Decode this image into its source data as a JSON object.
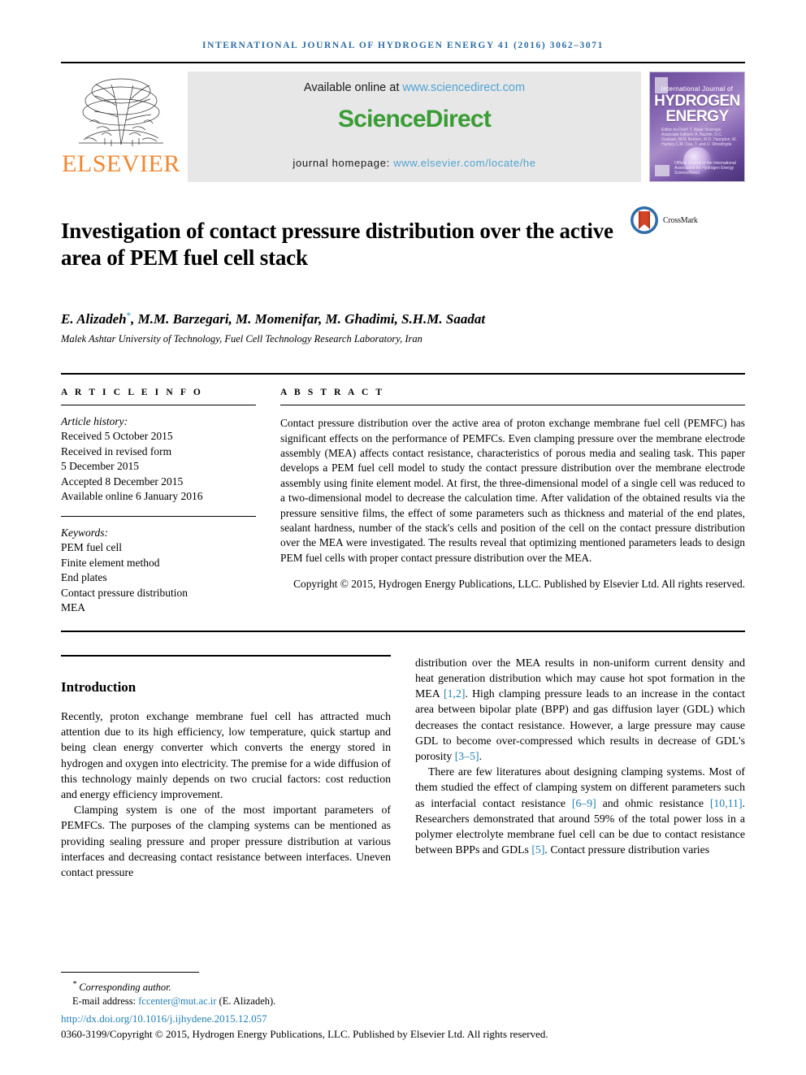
{
  "running_head": "International Journal of Hydrogen Energy 41 (2016) 3062–3071",
  "masthead": {
    "publisher_name": "ELSEVIER",
    "tree_logo_name": "elsevier-tree-logo",
    "available_prefix": "Available online at ",
    "sciencedirect_url": "www.sciencedirect.com",
    "sciencedirect_logo": "ScienceDirect",
    "homepage_prefix": "journal homepage: ",
    "homepage_url": "www.elsevier.com/locate/he",
    "cover": {
      "line_top": "International Journal of",
      "line_1": "HYDROGEN",
      "line_2": "ENERGY",
      "editors": "Editor-in-Chief: T. Nejat Veziroglu    Associate Editors: A. Bazhin, D.C. Graham, M.N. Ibrahim, M.D. Hampton, M. Hartley, L.M. Das, T. and D. Woodrigde",
      "footer_note": "Official Journal of the International Association for Hydrogen Energy    ScienceDirect"
    }
  },
  "article": {
    "title": "Investigation of contact pressure distribution over the active area of PEM fuel cell stack",
    "crossmark_label": "CrossMark",
    "authors": "E. Alizadeh, M.M. Barzegari, M. Momenifar, M. Ghadimi, S.H.M. Saadat",
    "author_marker": "*",
    "affiliation": "Malek Ashtar University of Technology, Fuel Cell Technology Research Laboratory, Iran"
  },
  "article_info": {
    "heading": "A R T I C L E   I N F O",
    "history_title": "Article history:",
    "history": [
      "Received 5 October 2015",
      "Received in revised form",
      "5 December 2015",
      "Accepted 8 December 2015",
      "Available online 6 January 2016"
    ],
    "keywords_title": "Keywords:",
    "keywords": [
      "PEM fuel cell",
      "Finite element method",
      "End plates",
      "Contact pressure distribution",
      "MEA"
    ]
  },
  "abstract": {
    "heading": "A B S T R A C T",
    "body": "Contact pressure distribution over the active area of proton exchange membrane fuel cell (PEMFC) has significant effects on the performance of PEMFCs. Even clamping pressure over the membrane electrode assembly (MEA) affects contact resistance, characteristics of porous media and sealing task. This paper develops a PEM fuel cell model to study the contact pressure distribution over the membrane electrode assembly using finite element model. At first, the three-dimensional model of a single cell was reduced to a two-dimensional model to decrease the calculation time. After validation of the obtained results via the pressure sensitive films, the effect of some parameters such as thickness and material of the end plates, sealant hardness, number of the stack's cells and position of the cell on the contact pressure distribution over the MEA were investigated. The results reveal that optimizing mentioned parameters leads to design PEM fuel cells with proper contact pressure distribution over the MEA.",
    "copyright": "Copyright © 2015, Hydrogen Energy Publications, LLC. Published by Elsevier Ltd. All rights reserved."
  },
  "introduction": {
    "heading": "Introduction",
    "left_paragraphs": [
      "Recently, proton exchange membrane fuel cell has attracted much attention due to its high efficiency, low temperature, quick startup and being clean energy converter which converts the energy stored in hydrogen and oxygen into electricity. The premise for a wide diffusion of this technology mainly depends on two crucial factors: cost reduction and energy efficiency improvement.",
      "Clamping system is one of the most important parameters of PEMFCs. The purposes of the clamping systems can be mentioned as providing sealing pressure and proper pressure distribution at various interfaces and decreasing contact resistance between interfaces. Uneven contact pressure"
    ],
    "right_paragraph_1_part1": "distribution over the MEA results in non-uniform current density and heat generation distribution which may cause hot spot formation in the MEA ",
    "right_cite_1": "[1,2]",
    "right_paragraph_1_part2": ". High clamping pressure leads to an increase in the contact area between bipolar plate (BPP) and gas diffusion layer (GDL) which decreases the contact resistance. However, a large pressure may cause GDL to become over-compressed which results in decrease of GDL's porosity ",
    "right_cite_2": "[3–5]",
    "right_paragraph_1_part3": ".",
    "right_paragraph_2_part1": "There are few literatures about designing clamping systems. Most of them studied the effect of clamping system on different parameters such as interfacial contact resistance ",
    "right_cite_3": "[6–9]",
    "right_paragraph_2_part2": " and ohmic resistance ",
    "right_cite_4": "[10,11]",
    "right_paragraph_2_part3": ". Researchers demonstrated that around 59% of the total power loss in a polymer electrolyte membrane fuel cell can be due to contact resistance between BPPs and GDLs ",
    "right_cite_5": "[5]",
    "right_paragraph_2_part4": ". Contact pressure distribution varies"
  },
  "footer": {
    "corresponding_marker": "*",
    "corresponding_text": "Corresponding author.",
    "email_label": "E-mail address: ",
    "email": "fccenter@mut.ac.ir",
    "email_suffix": " (E. Alizadeh).",
    "doi": "http://dx.doi.org/10.1016/j.ijhydene.2015.12.057",
    "issn_copyright": "0360-3199/Copyright © 2015, Hydrogen Energy Publications, LLC. Published by Elsevier Ltd. All rights reserved."
  },
  "colors": {
    "running_head_blue": "#2e6da4",
    "link_blue": "#1f7fb5",
    "elsevier_orange": "#f3862f",
    "sciencedirect_green": "#3a9c35"
  }
}
